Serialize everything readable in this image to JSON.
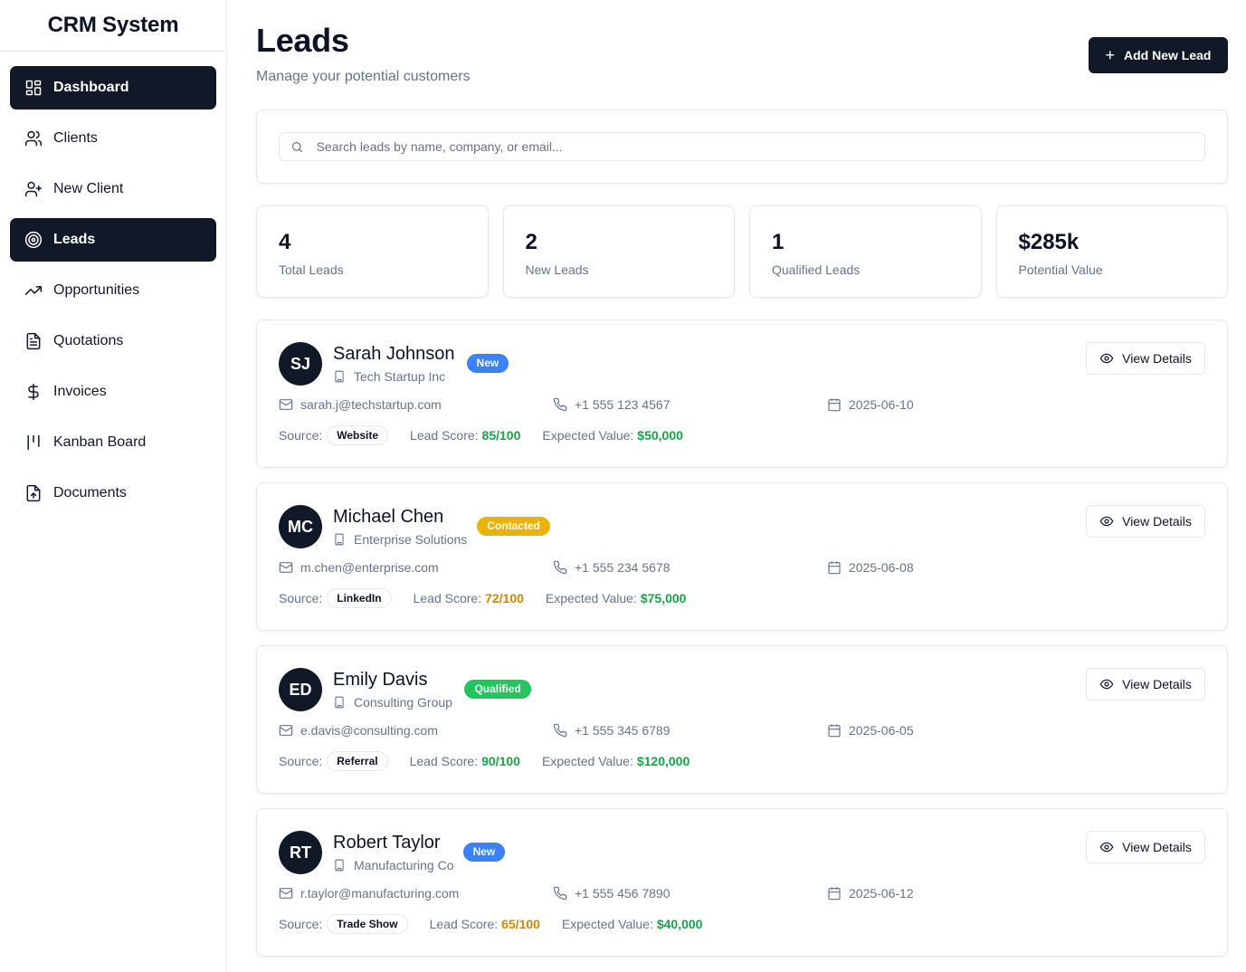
{
  "app": {
    "title": "CRM System"
  },
  "sidebar": {
    "items": [
      {
        "label": "Dashboard",
        "icon": "dashboard-icon",
        "active": true
      },
      {
        "label": "Clients",
        "icon": "users-icon",
        "active": false
      },
      {
        "label": "New Client",
        "icon": "user-plus-icon",
        "active": false
      },
      {
        "label": "Leads",
        "icon": "target-icon",
        "active": true
      },
      {
        "label": "Opportunities",
        "icon": "trending-up-icon",
        "active": false
      },
      {
        "label": "Quotations",
        "icon": "file-text-icon",
        "active": false
      },
      {
        "label": "Invoices",
        "icon": "dollar-icon",
        "active": false
      },
      {
        "label": "Kanban Board",
        "icon": "kanban-icon",
        "active": false
      },
      {
        "label": "Documents",
        "icon": "file-upload-icon",
        "active": false
      }
    ]
  },
  "header": {
    "title": "Leads",
    "subtitle": "Manage your potential customers",
    "add_button": "Add New Lead"
  },
  "search": {
    "placeholder": "Search leads by name, company, or email...",
    "value": ""
  },
  "stats": [
    {
      "value": "4",
      "label": "Total Leads"
    },
    {
      "value": "2",
      "label": "New Leads"
    },
    {
      "value": "1",
      "label": "Qualified Leads"
    },
    {
      "value": "$285k",
      "label": "Potential Value"
    }
  ],
  "labels": {
    "view_details": "View Details",
    "source": "Source:",
    "lead_score": "Lead Score:",
    "expected_value": "Expected Value:"
  },
  "colors": {
    "primary": "#111827",
    "status_new": "#3b82f6",
    "status_contacted": "#eab308",
    "status_qualified": "#22c55e",
    "score_high": "#16a34a",
    "score_mid": "#ca8a04",
    "value": "#16a34a"
  },
  "leads": [
    {
      "initials": "SJ",
      "name": "Sarah Johnson",
      "status": "New",
      "status_color": "#3b82f6",
      "company": "Tech Startup Inc",
      "email": "sarah.j@techstartup.com",
      "phone": "+1 555 123 4567",
      "date": "2025-06-10",
      "source": "Website",
      "score": "85/100",
      "score_color": "#16a34a",
      "value": "$50,000"
    },
    {
      "initials": "MC",
      "name": "Michael Chen",
      "status": "Contacted",
      "status_color": "#eab308",
      "company": "Enterprise Solutions",
      "email": "m.chen@enterprise.com",
      "phone": "+1 555 234 5678",
      "date": "2025-06-08",
      "source": "LinkedIn",
      "score": "72/100",
      "score_color": "#ca8a04",
      "value": "$75,000"
    },
    {
      "initials": "ED",
      "name": "Emily Davis",
      "status": "Qualified",
      "status_color": "#22c55e",
      "company": "Consulting Group",
      "email": "e.davis@consulting.com",
      "phone": "+1 555 345 6789",
      "date": "2025-06-05",
      "source": "Referral",
      "score": "90/100",
      "score_color": "#16a34a",
      "value": "$120,000"
    },
    {
      "initials": "RT",
      "name": "Robert Taylor",
      "status": "New",
      "status_color": "#3b82f6",
      "company": "Manufacturing Co",
      "email": "r.taylor@manufacturing.com",
      "phone": "+1 555 456 7890",
      "date": "2025-06-12",
      "source": "Trade Show",
      "score": "65/100",
      "score_color": "#ca8a04",
      "value": "$40,000"
    }
  ]
}
